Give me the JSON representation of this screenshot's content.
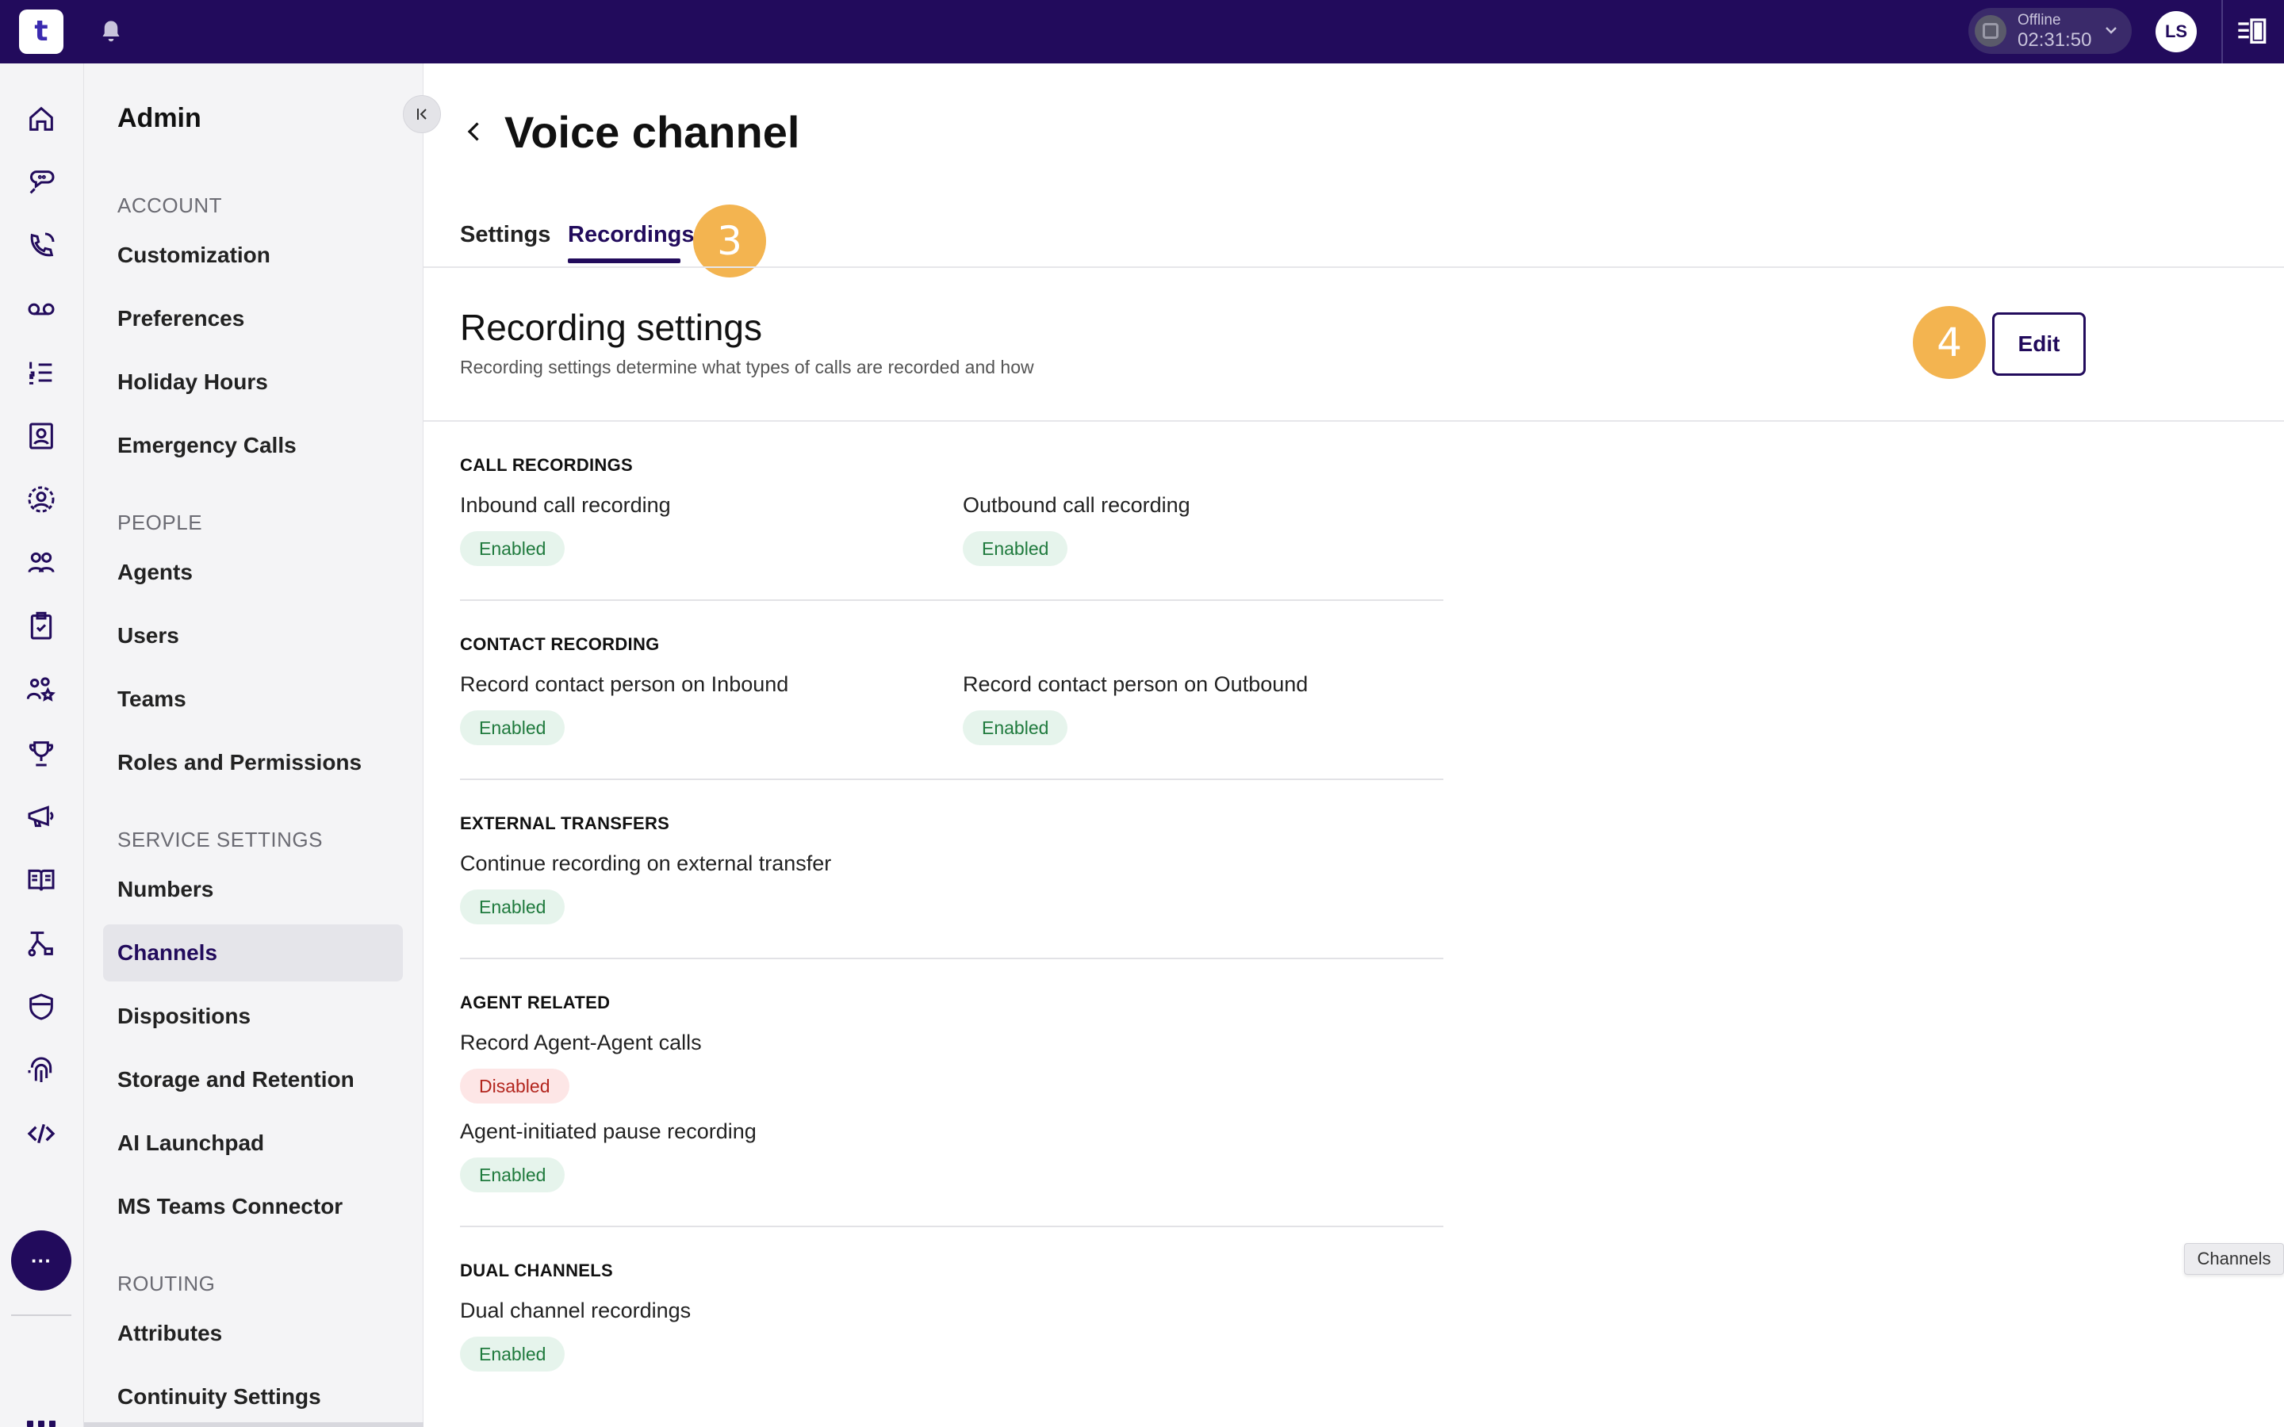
{
  "topbar": {
    "logo_text": "t",
    "status_label": "Offline",
    "status_time": "02:31:50",
    "avatar_initials": "LS"
  },
  "rail": {
    "icons": [
      "home-icon",
      "chat-icon",
      "phone-icon",
      "voicemail-icon",
      "list-icon",
      "contacts-icon",
      "profile-icon",
      "people-icon",
      "clipboard-icon",
      "team-star-icon",
      "trophy-icon",
      "megaphone-icon",
      "book-icon",
      "flow-icon",
      "shield-icon",
      "fingerprint-icon",
      "code-icon"
    ],
    "more_label": "···"
  },
  "sidebar": {
    "title": "Admin",
    "sections": [
      {
        "label": "ACCOUNT",
        "items": [
          "Customization",
          "Preferences",
          "Holiday Hours",
          "Emergency Calls"
        ]
      },
      {
        "label": "PEOPLE",
        "items": [
          "Agents",
          "Users",
          "Teams",
          "Roles and Permissions"
        ]
      },
      {
        "label": "SERVICE SETTINGS",
        "items": [
          "Numbers",
          "Channels",
          "Dispositions",
          "Storage and Retention",
          "AI Launchpad",
          "MS Teams Connector"
        ]
      },
      {
        "label": "ROUTING",
        "items": [
          "Attributes",
          "Continuity Settings"
        ]
      }
    ],
    "active_item": "Channels"
  },
  "main": {
    "title": "Voice channel",
    "tabs": [
      {
        "label": "Settings"
      },
      {
        "label": "Recordings"
      }
    ],
    "active_tab": "Recordings",
    "badges": {
      "tabs": "3",
      "edit": "4"
    },
    "header": {
      "title": "Recording settings",
      "subtitle": "Recording settings determine what types of calls are recorded and how",
      "edit_label": "Edit"
    },
    "groups": [
      {
        "title": "CALL RECORDINGS",
        "fields": [
          {
            "label": "Inbound call recording",
            "status": "Enabled"
          },
          {
            "label": "Outbound call recording",
            "status": "Enabled"
          }
        ]
      },
      {
        "title": "CONTACT RECORDING",
        "fields": [
          {
            "label": "Record contact person on Inbound",
            "status": "Enabled"
          },
          {
            "label": "Record contact person on Outbound",
            "status": "Enabled"
          }
        ]
      },
      {
        "title": "EXTERNAL TRANSFERS",
        "fields": [
          {
            "label": "Continue recording on external transfer",
            "status": "Enabled"
          }
        ]
      },
      {
        "title": "AGENT RELATED",
        "fields": [
          {
            "label": "Record Agent-Agent calls",
            "status": "Disabled"
          },
          {
            "label": "Agent-initiated pause recording",
            "status": "Enabled"
          }
        ]
      },
      {
        "title": "DUAL CHANNELS",
        "fields": [
          {
            "label": "Dual channel recordings",
            "status": "Enabled"
          }
        ]
      }
    ]
  },
  "tooltip": {
    "text": "Channels"
  },
  "colors": {
    "brand": "#220b5c",
    "badge": "#f3b450",
    "enabled_bg": "#e6f4ec",
    "enabled_text": "#1f7a3d",
    "disabled_bg": "#fde6e6",
    "disabled_text": "#b3261e"
  }
}
